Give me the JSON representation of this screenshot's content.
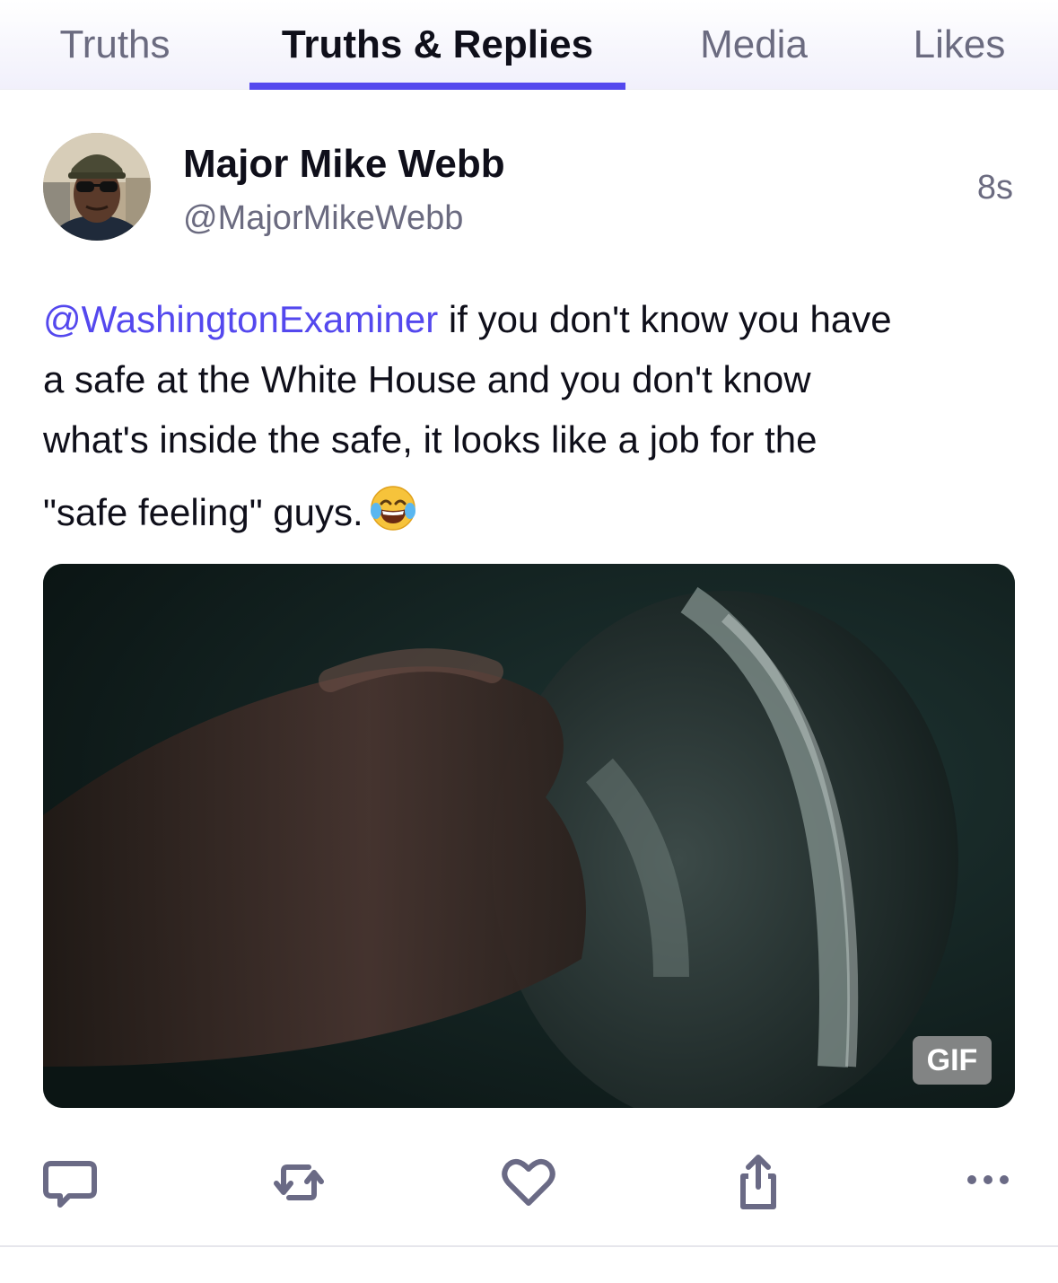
{
  "tabs": [
    {
      "label": "Truths",
      "active": false
    },
    {
      "label": "Truths & Replies",
      "active": true
    },
    {
      "label": "Media",
      "active": false
    },
    {
      "label": "Likes",
      "active": false
    }
  ],
  "post": {
    "author_name": "Major Mike Webb",
    "author_handle": "@MajorMikeWebb",
    "timestamp": "8s",
    "mention": "@WashingtonExaminer",
    "text_line1_rest": " if you don't know you have",
    "text_line2": "a safe at the White House and you don't know",
    "text_line3": "what's inside the safe, it looks like a job for the",
    "text_line4": "\"safe feeling\" guys.",
    "emoji": "face-with-tears-of-joy",
    "media_badge": "GIF"
  },
  "actions": [
    "reply-icon",
    "repost-icon",
    "like-icon",
    "share-icon",
    "more-icon"
  ],
  "colors": {
    "accent": "#5448ee",
    "muted_text": "#6b6b80",
    "primary_text": "#0f0f1a"
  }
}
